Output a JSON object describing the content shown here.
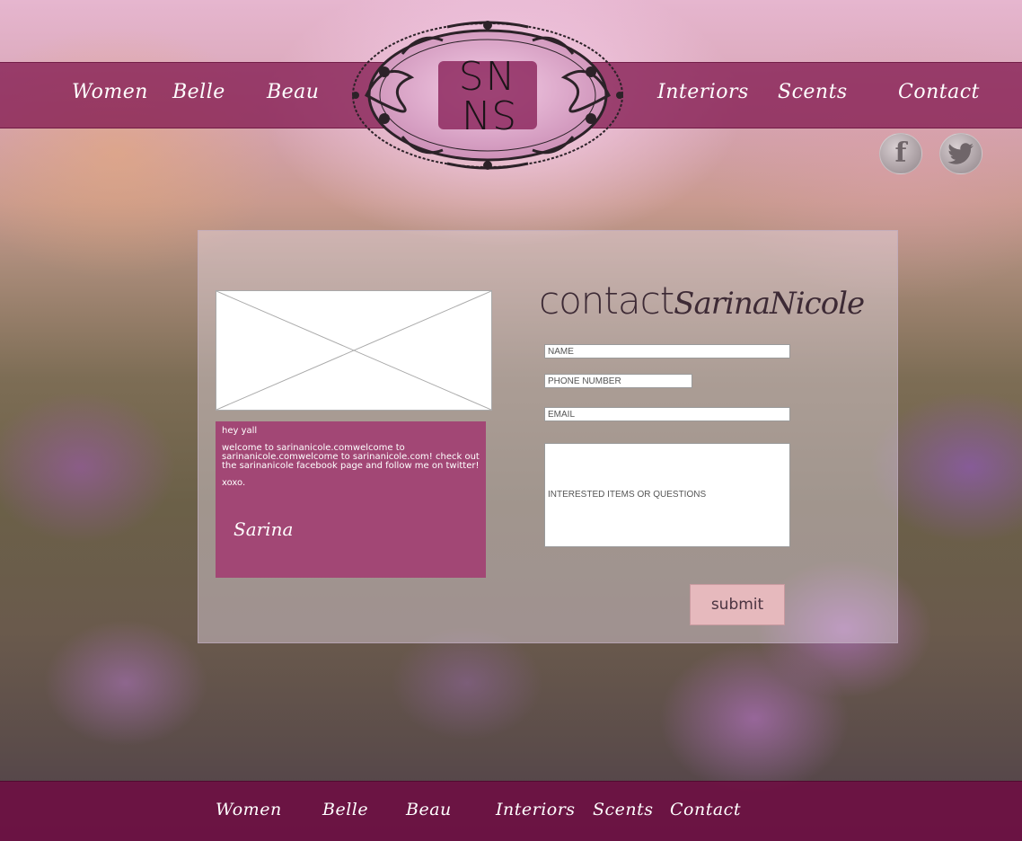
{
  "nav": {
    "items": [
      {
        "label": "Women"
      },
      {
        "label": "Belle"
      },
      {
        "label": "Beau"
      },
      {
        "label": "Interiors"
      },
      {
        "label": "Scents"
      },
      {
        "label": "Contact"
      }
    ]
  },
  "logo": {
    "monogram": "SN"
  },
  "social": {
    "facebook_icon": "facebook-icon",
    "twitter_icon": "twitter-icon"
  },
  "welcome": {
    "greeting": "hey yall",
    "body": "welcome to sarinanicole.comwelcome to sarinanicole.comwelcome to sarinanicole.com! check out the sarinanicole facebook page and follow me on twitter!",
    "signoff": "xoxo.",
    "signature": "Sarina"
  },
  "contact": {
    "heading_word": "contact",
    "heading_name": "SarinaNicole",
    "fields": {
      "name_placeholder": "NAME",
      "phone_placeholder": "PHONE NUMBER",
      "email_placeholder": "EMAIL",
      "message_placeholder": "INTERESTED ITEMS OR QUESTIONS"
    },
    "submit_label": "submit"
  },
  "footer": {
    "items": [
      {
        "label": "Women"
      },
      {
        "label": "Belle"
      },
      {
        "label": "Beau"
      },
      {
        "label": "Interiors"
      },
      {
        "label": "Scents"
      },
      {
        "label": "Contact"
      }
    ]
  },
  "colors": {
    "nav_bar": "#841c52",
    "welcome_box": "#a24775",
    "footer_bar": "#6e0e42",
    "submit_button": "#e6b9bd"
  }
}
